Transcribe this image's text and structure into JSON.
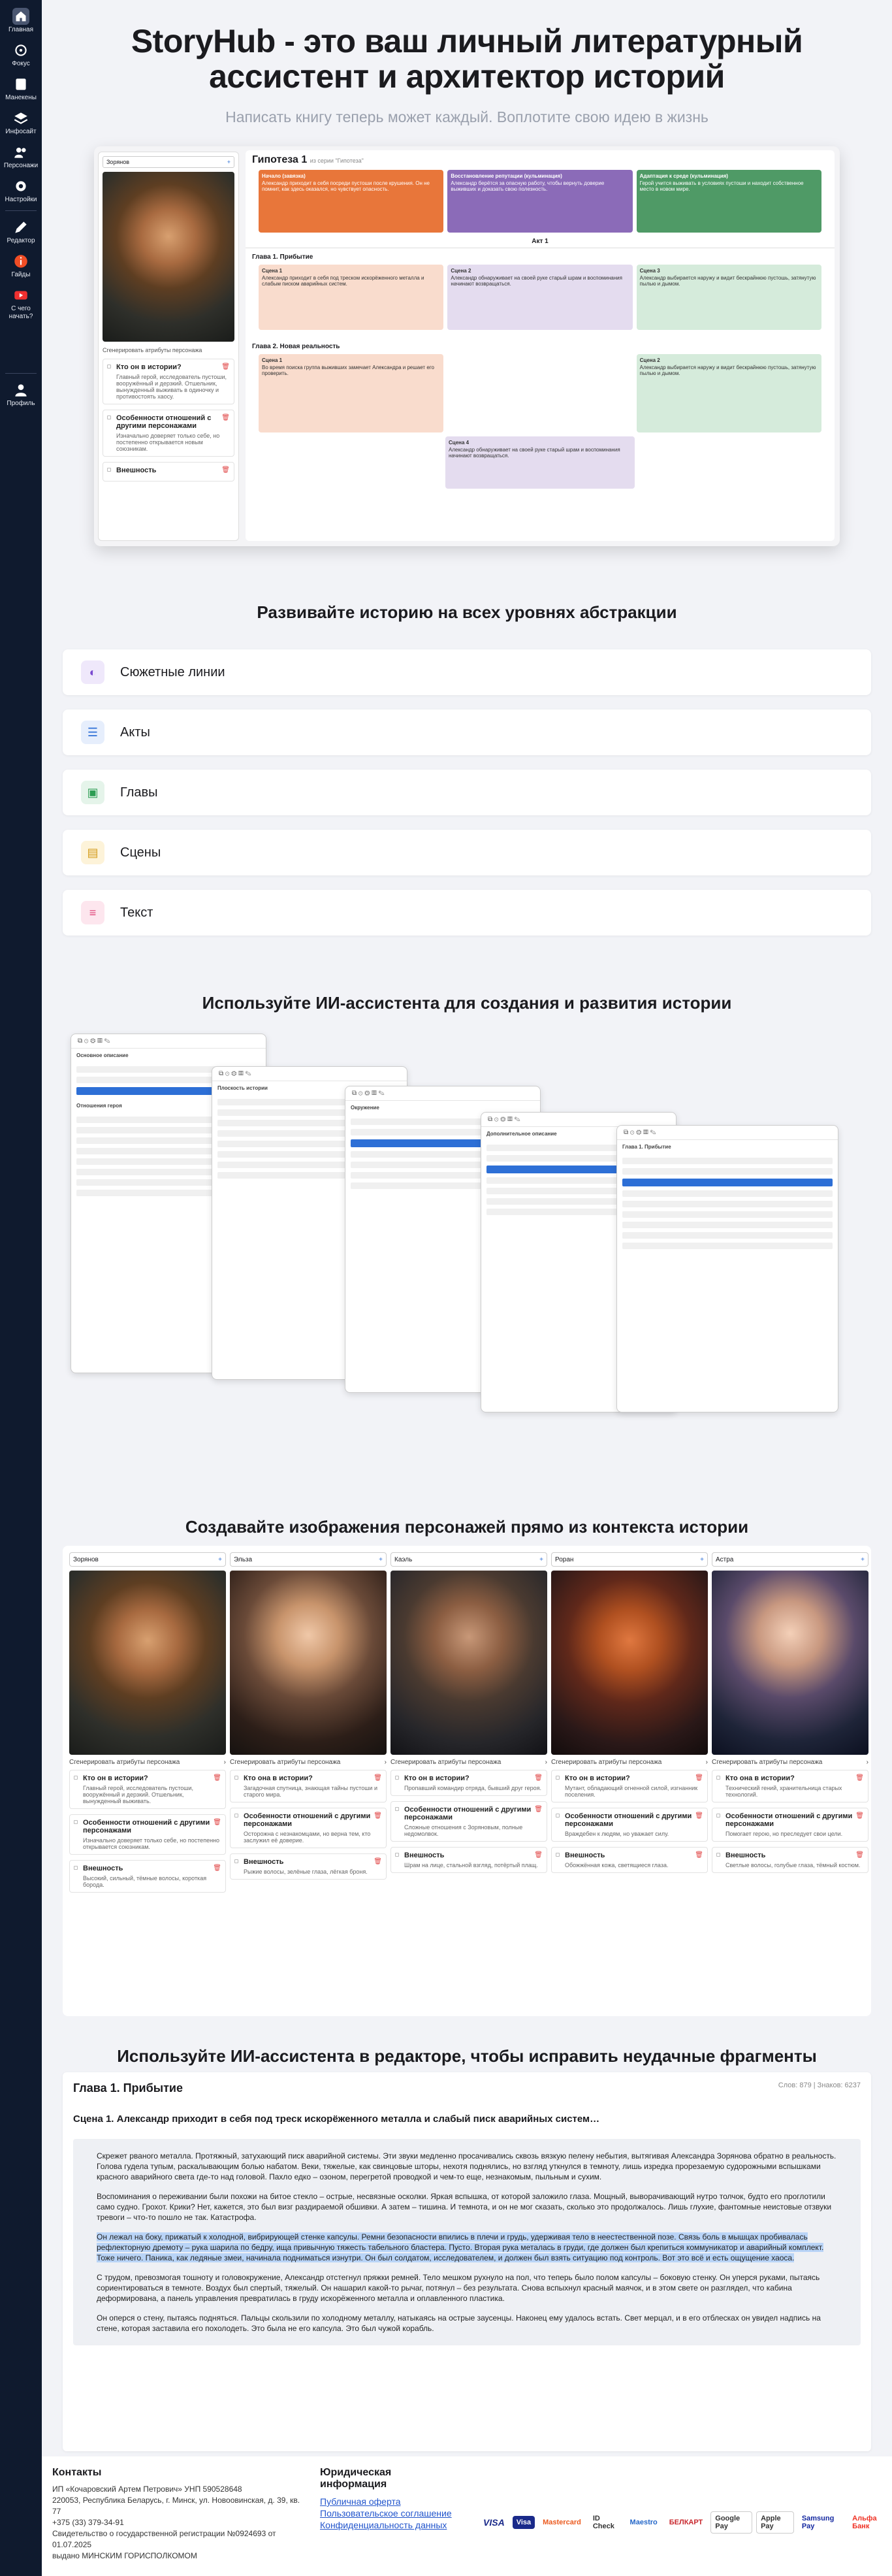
{
  "sidebar": {
    "items": [
      {
        "label": "Главная",
        "icon": "home-icon"
      },
      {
        "label": "Фокус",
        "icon": "crosshair-icon"
      },
      {
        "label": "Манекены",
        "icon": "book-icon"
      },
      {
        "label": "Инфосайт",
        "icon": "layers-icon"
      },
      {
        "label": "Персонажи",
        "icon": "users-icon"
      },
      {
        "label": "Настройки",
        "icon": "gear-icon"
      },
      {
        "label": "Редактор",
        "icon": "pen-icon"
      },
      {
        "label": "Гайды",
        "icon": "info-icon"
      },
      {
        "label": "С чего начать?",
        "icon": "youtube-icon"
      },
      {
        "label": "Профиль",
        "icon": "user-icon"
      }
    ]
  },
  "hero": {
    "title_line1": "StoryHub - это ваш личный литературный",
    "title_line2": "ассистент и архитектор историй",
    "subtitle": "Написать книгу теперь может каждый. Воплотите свою идею в жизнь"
  },
  "screenshot1": {
    "char_name": "Зорянов",
    "generate": "Сгенерировать атрибуты персонажа",
    "q1_title": "Кто он в истории?",
    "q1_text": "Главный герой, исследователь пустоши, вооружённый и дерзкий. Отшельник, вынужденный выживать в одиночку и противостоять хаосу.",
    "q2_title": "Особенности отношений с другими персонажами",
    "q2_text": "Изначально доверяет только себе, но постепенно открывается новым союзникам.",
    "q3_title": "Внешность",
    "hypothesis_title": "Гипотеза 1",
    "hypothesis_sub": "из серии \"Гипотеза\"",
    "col1_title": "Начало (завязка)",
    "col2_title": "Восстановление репутации (кульминация)",
    "col3_title": "Адаптация к среде (кульминация)",
    "col1_text": "Александр приходит в себя посреди пустоши после крушения. Он не помнит, как здесь оказался, но чувствует опасность.",
    "col2_text": "Александр берётся за опасную работу, чтобы вернуть доверие выживших и доказать свою полезность.",
    "col3_text": "Герой учится выживать в условиях пустоши и находит собственное место в новом мире.",
    "act": "Акт 1",
    "ch1": "Глава 1. Прибытие",
    "ch2": "Глава 2. Новая реальность",
    "scene1": "Сцена 1",
    "scene2": "Сцена 2",
    "scene3": "Сцена 3",
    "scene4": "Сцена 4",
    "scene_text_a": "Александр приходит в себя под треском искорёженного металла и слабым писком аварийных систем.",
    "scene_text_b": "Александр обнаруживает на своей руке старый шрам и воспоминания начинают возвращаться.",
    "scene_text_c": "Александр выбирается наружу и видит бескрайнюю пустошь, затянутую пылью и дымом.",
    "scene_text_d": "Во время поиска группа выживших замечает Александра и решает его проверить."
  },
  "levels": {
    "title": "Развивайте историю на всех уровнях абстракции",
    "items": [
      "Сюжетные линии",
      "Акты",
      "Главы",
      "Сцены",
      "Текст"
    ]
  },
  "assistant": {
    "title": "Используйте ИИ-ассистента для создания и развития истории",
    "win_labels": [
      "Основное описание",
      "Отношения героя",
      "Плоскость истории",
      "Окружение",
      "Дополнительное описание",
      "Глава 1. Прибытие"
    ],
    "action": "Сгенерировать"
  },
  "characters": {
    "title": "Создавайте изображения персонажей прямо из контекста истории",
    "generate": "Сгенерировать атрибуты персонажа",
    "q_role": "Кто он в истории?",
    "q_role_f": "Кто она в истории?",
    "q_rel": "Особенности отношений с другими персонажами",
    "q_look": "Внешность",
    "list": [
      {
        "name": "Зорянов",
        "role": "Главный герой, исследователь пустоши, вооружённый и дерзкий. Отшельник, вынужденный выживать.",
        "rel": "Изначально доверяет только себе, но постепенно открывается союзникам.",
        "look": "Высокий, сильный, тёмные волосы, короткая борода."
      },
      {
        "name": "Эльза",
        "role": "Загадочная спутница, знающая тайны пустоши и старого мира.",
        "rel": "Осторожна с незнакомцами, но верна тем, кто заслужил её доверие.",
        "look": "Рыжие волосы, зелёные глаза, лёгкая броня."
      },
      {
        "name": "Каэль",
        "role": "Пропавший командир отряда, бывший друг героя.",
        "rel": "Сложные отношения с Зоряновым, полные недомолвок.",
        "look": "Шрам на лице, стальной взгляд, потёртый плащ."
      },
      {
        "name": "Роран",
        "role": "Мутант, обладающий огненной силой, изгнанник поселения.",
        "rel": "Враждебен к людям, но уважает силу.",
        "look": "Обожжённая кожа, светящиеся глаза."
      },
      {
        "name": "Астра",
        "role": "Технический гений, хранительница старых технологий.",
        "rel": "Помогает герою, но преследует свои цели.",
        "look": "Светлые волосы, голубые глаза, тёмный костюм."
      }
    ]
  },
  "editor": {
    "section_title": "Используйте ИИ-ассистента в редакторе, чтобы исправить неудачные фрагменты",
    "chapter": "Глава 1. Прибытие",
    "stats": "Слов: 879 | Знаков: 6237",
    "scene_title": "Сцена 1. Александр приходит в себя под треск искорёженного металла и слабый писк аварийных систем…",
    "p1": "Скрежет рваного металла. Протяжный, затухающий писк аварийной системы. Эти звуки медленно просачивались сквозь вязкую пелену небытия, вытягивая Александра Зорянова обратно в реальность. Голова гудела тупым, раскалывающим болью набатом. Веки, тяжелые, как свинцовые шторы, нехотя поднялись, но взгляд уткнулся в темноту, лишь изредка прорезаемую судорожными вспышками красного аварийного света где-то над головой. Пахло едко – озоном, перегретой проводкой и чем-то еще, незнакомым, пыльным и сухим.",
    "p2": "Воспоминания о переживании были похожи на битое стекло – острые, несвязные осколки. Яркая вспышка, от которой заложило глаза. Мощный, выворачивающий нутро толчок, будто его проглотили само судно. Грохот. Крики? Нет, кажется, это был визг раздираемой обшивки. А затем – тишина. И темнота, и он не мог сказать, сколько это продолжалось. Лишь глухие, фантомные неистовые отзвуки тревоги – что-то пошло не так. Катастрофа.",
    "p3_highlight": "Он лежал на боку, прижатый к холодной, вибрирующей стенке капсулы. Ремни безопасности впились в плечи и грудь, удерживая тело в неестественной позе. Связь боль в мышцах пробивалась рефлекторную дремоту – рука шарила по бедру, ища привычную тяжесть табельного бластера. Пусто. Вторая рука металась в груди, где должен был крепиться коммуникатор и аварийный комплект. Тоже ничего. Паника, как ледяные змеи, начинала подниматься изнутри. Он был солдатом, исследователем, и должен был взять ситуацию под контроль. Вот это всё и есть ощущение хаоса.",
    "p4": "С трудом, превозмогая тошноту и головокружение, Александр отстегнул пряжки ремней. Тело мешком рухнуло на пол, что теперь было полом капсулы – боковую стенку. Он уперся руками, пытаясь сориентироваться в темноте. Воздух был спертый, тяжелый. Он нашарил какой-то рычаг, потянул – без результата. Снова вспыхнул красный маячок, и в этом свете он разглядел, что кабина деформирована, а панель управления превратилась в груду искорёженного металла и оплавленного пластика.",
    "p5": "Он оперся о стену, пытаясь подняться. Пальцы скользили по холодному металлу, натыкаясь на острые заусенцы. Наконец ему удалось встать. Свет мерцал, и в его отблесках он увидел надпись на стене, которая заставила его похолодеть. Это была не его капсула. Это был чужой корабль."
  },
  "footer": {
    "contacts_title": "Контакты",
    "contacts_lines": [
      "ИП «Кочаровский Артем Петрович» УНП 590528648",
      "220053, Республика Беларусь, г. Минск, ул. Новоовинская, д. 39, кв. 77",
      "+375 (33) 379-34-91",
      "Свидетельство о государственной регистрации №0924693 от 01.07.2025",
      "выдано МИНСКИМ ГОРИСПОЛКОМОМ"
    ],
    "legal_title": "Юридическая информация",
    "legal_links": [
      "Публичная оферта",
      "Пользовательское соглашение",
      "Конфиденциальность данных"
    ],
    "payments": [
      "VISA",
      "Visa",
      "Mastercard",
      "ID Check",
      "Maestro",
      "БЕЛКАРТ",
      "Google Pay",
      "Apple Pay",
      "Samsung Pay",
      "Альфа Банк"
    ]
  },
  "colors": {
    "accent": "#2d6fd6",
    "sidebar": "#0f1a2e",
    "orange": "#e8763a",
    "purple": "#8b6bb8",
    "green": "#4f9a66",
    "highlight": "#b9d4f7"
  }
}
